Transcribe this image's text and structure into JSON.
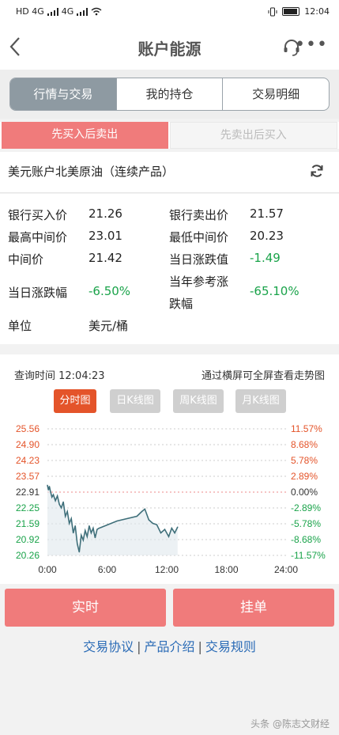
{
  "status_bar": {
    "network_left": "HD 4G",
    "network_right": "4G",
    "time": "12:04"
  },
  "header": {
    "title": "账户能源",
    "more_label": "•••"
  },
  "segments": [
    {
      "label": "行情与交易",
      "active": true
    },
    {
      "label": "我的持仓",
      "active": false
    },
    {
      "label": "交易明细",
      "active": false
    }
  ],
  "order_tabs": [
    {
      "label": "先买入后卖出",
      "active": true
    },
    {
      "label": "先卖出后买入",
      "active": false
    }
  ],
  "product": {
    "name": "美元账户北美原油（连续产品）"
  },
  "quotes": {
    "bank_buy_label": "银行买入价",
    "bank_buy": "21.26",
    "bank_sell_label": "银行卖出价",
    "bank_sell": "21.57",
    "high_mid_label": "最高中间价",
    "high_mid": "23.01",
    "low_mid_label": "最低中间价",
    "low_mid": "20.23",
    "mid_label": "中间价",
    "mid": "21.42",
    "day_change_label": "当日涨跌值",
    "day_change": "-1.49",
    "day_pct_label": "当日涨跌幅",
    "day_pct": "-6.50%",
    "year_pct_label_1": "当年参考涨",
    "year_pct_label_2": "跌幅",
    "year_pct": "-65.10%",
    "unit_label": "单位",
    "unit": "美元/桶"
  },
  "chart_header": {
    "query_time": "查询时间 12:04:23",
    "hint": "通过横屏可全屏查看走势图"
  },
  "chart_tabs": [
    {
      "label": "分时图",
      "active": true
    },
    {
      "label": "日K线图",
      "active": false
    },
    {
      "label": "周K线图",
      "active": false
    },
    {
      "label": "月K线图",
      "active": false
    }
  ],
  "colors": {
    "accent": "#f07b7b",
    "active_tab": "#e4542a",
    "up": "#e4542a",
    "down": "#1aa34a",
    "link": "#2a6bb6",
    "line": "#3f6f7a"
  },
  "chart_data": {
    "type": "line",
    "title": "",
    "xlabel": "",
    "ylabel": "",
    "x_ticks": [
      "0:00",
      "6:00",
      "12:00",
      "18:00",
      "24:00"
    ],
    "x_range_hours": [
      0,
      24
    ],
    "y_left_ticks": [
      "25.56",
      "24.90",
      "24.23",
      "23.57",
      "22.91",
      "22.25",
      "21.59",
      "20.92",
      "20.26"
    ],
    "y_right_ticks": [
      "11.57%",
      "8.68%",
      "5.78%",
      "2.89%",
      "0.00%",
      "-2.89%",
      "-5.78%",
      "-8.68%",
      "-11.57%"
    ],
    "y_range": [
      20.26,
      25.56
    ],
    "reference_value": 22.91,
    "grid": true,
    "x_hours": [
      0.0,
      0.1,
      0.2,
      0.3,
      0.45,
      0.6,
      0.8,
      1.0,
      1.2,
      1.4,
      1.6,
      1.8,
      2.0,
      2.2,
      2.4,
      2.6,
      2.8,
      3.0,
      3.2,
      3.4,
      3.6,
      3.8,
      4.0,
      4.2,
      4.4,
      4.6,
      4.8,
      5.0,
      5.2,
      7.0,
      9.0,
      9.5,
      9.8,
      10.2,
      10.6,
      11.0,
      11.4,
      11.8,
      12.2,
      12.5,
      12.8,
      13.1
    ],
    "values": [
      23.2,
      23.0,
      23.15,
      22.95,
      22.7,
      22.8,
      22.55,
      22.75,
      22.4,
      22.25,
      22.5,
      21.9,
      22.1,
      21.6,
      21.8,
      21.2,
      21.5,
      20.75,
      20.4,
      21.1,
      20.9,
      21.3,
      21.05,
      21.5,
      21.2,
      21.4,
      21.0,
      21.35,
      21.4,
      21.7,
      21.9,
      22.1,
      22.2,
      21.75,
      21.6,
      21.55,
      21.2,
      21.35,
      21.05,
      21.4,
      21.2,
      21.45
    ]
  },
  "actions": {
    "realtime": "实时",
    "pending": "挂单"
  },
  "links": [
    "交易协议",
    "产品介绍",
    "交易规则"
  ],
  "link_sep": "|",
  "watermark": "头条 @陈志文财经"
}
